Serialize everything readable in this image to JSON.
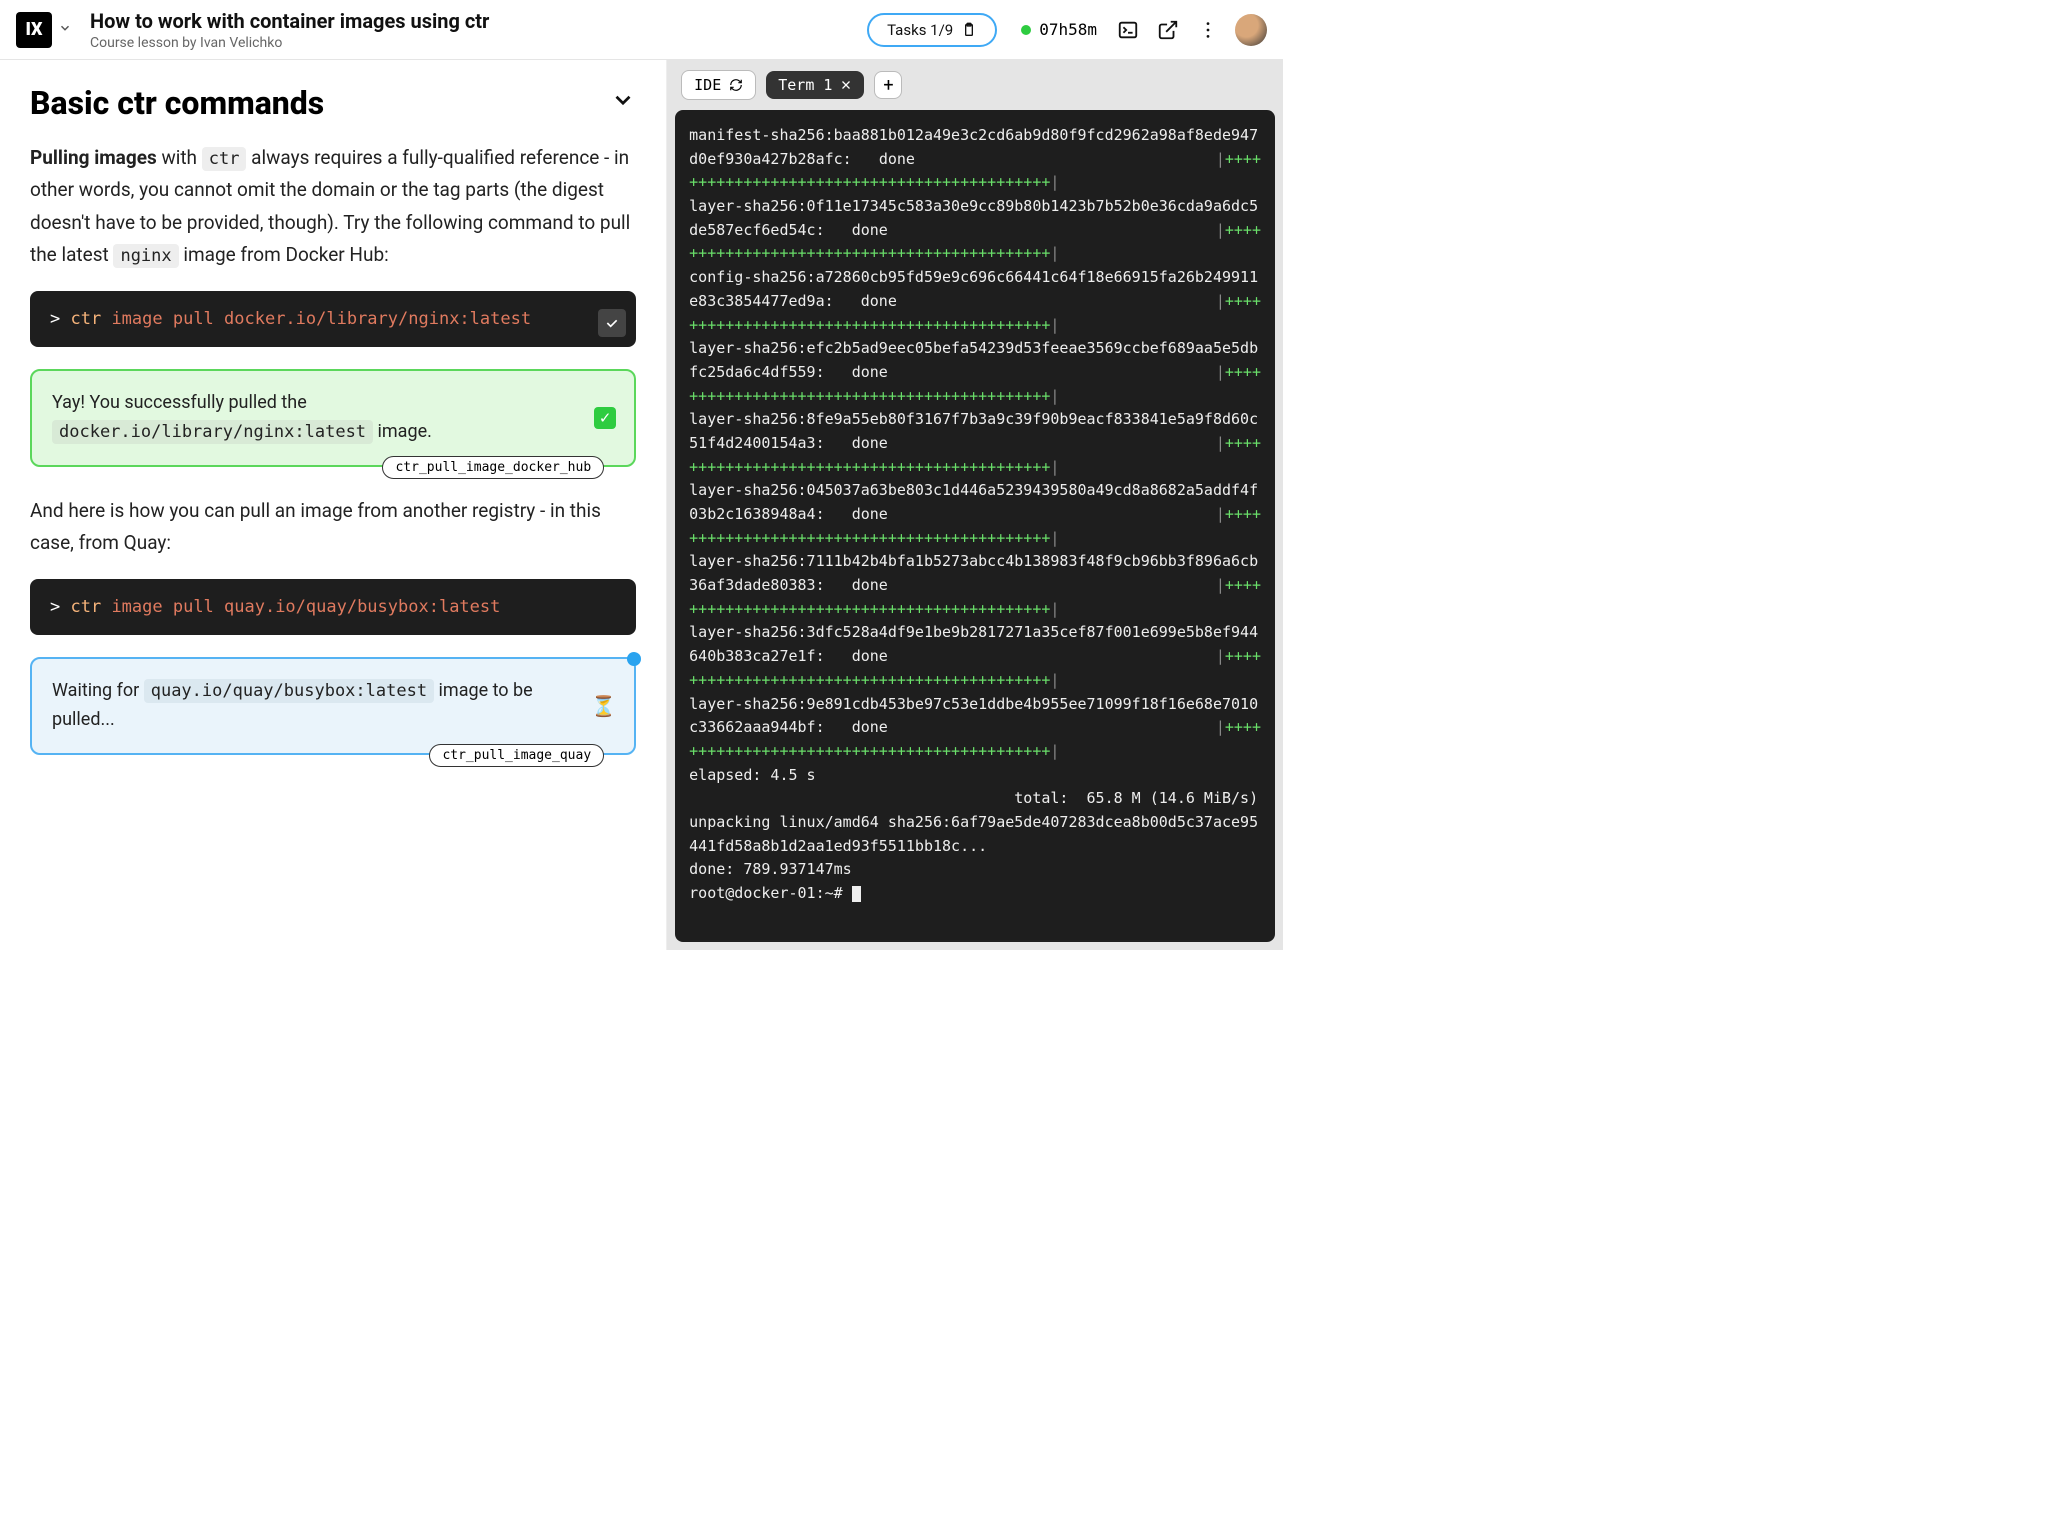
{
  "header": {
    "logo_text": "IX",
    "title": "How to work with container images using ctr",
    "subtitle": "Course lesson by Ivan Velichko",
    "tasks_label": "Tasks 1/9",
    "timer": "07h58m"
  },
  "lesson": {
    "section_title": "Basic ctr commands",
    "para1_strong": "Pulling images",
    "para1_a": " with ",
    "para1_code": "ctr",
    "para1_b": " always requires a fully-qualified reference - in other words, you cannot omit the domain or the tag parts (the digest doesn't have to be provided, though). Try the following command to pull the latest ",
    "para1_code2": "nginx",
    "para1_c": " image from Docker Hub:",
    "code1": {
      "prompt": "> ",
      "ctr": "ctr",
      "rest": " image pull docker.io/library/nginx:latest"
    },
    "success": {
      "text_a": "Yay! You successfully pulled the ",
      "code": "docker.io/library/nginx:latest",
      "text_b": " image.",
      "tag": "ctr_pull_image_docker_hub"
    },
    "para2": "And here is how you can pull an image from another registry - in this case, from Quay:",
    "code2": {
      "prompt": "> ",
      "ctr": "ctr",
      "rest": " image pull quay.io/quay/busybox:latest"
    },
    "waiting": {
      "text_a": "Waiting for ",
      "code": "quay.io/quay/busybox:latest",
      "text_b": " image to be pulled...",
      "tag": "ctr_pull_image_quay"
    }
  },
  "term_tabs": {
    "ide": "IDE",
    "term1": "Term 1"
  },
  "terminal": {
    "lines": [
      {
        "t": "hash",
        "txt": "manifest-sha256:baa881b012a49e3c2cd6ab9d80f9fcd2962a98af8ede947d0ef930a427b28afc:",
        "status": "done"
      },
      {
        "t": "plusline"
      },
      {
        "t": "hash",
        "txt": "layer-sha256:0f11e17345c583a30e9cc89b80b1423b7b52b0e36cda9a6dc5de587ecf6ed54c:",
        "status": "done"
      },
      {
        "t": "plusline"
      },
      {
        "t": "hash",
        "txt": "config-sha256:a72860cb95fd59e9c696c66441c64f18e66915fa26b249911e83c3854477ed9a:",
        "status": "done"
      },
      {
        "t": "plusline"
      },
      {
        "t": "hash",
        "txt": "layer-sha256:efc2b5ad9eec05befa54239d53feeae3569ccbef689aa5e5dbfc25da6c4df559:",
        "status": "done"
      },
      {
        "t": "plusline"
      },
      {
        "t": "hash",
        "txt": "layer-sha256:8fe9a55eb80f3167f7b3a9c39f90b9eacf833841e5a9f8d60c51f4d2400154a3:",
        "status": "done"
      },
      {
        "t": "plusline"
      },
      {
        "t": "hash",
        "txt": "layer-sha256:045037a63be803c1d446a5239439580a49cd8a8682a5addf4f03b2c1638948a4:",
        "status": "done"
      },
      {
        "t": "plusline"
      },
      {
        "t": "hash",
        "txt": "layer-sha256:7111b42b4bfa1b5273abcc4b138983f48f9cb96bb3f896a6cb36af3dade80383:",
        "status": "done"
      },
      {
        "t": "plusline"
      },
      {
        "t": "hash",
        "txt": "layer-sha256:3dfc528a4df9e1be9b2817271a35cef87f001e699e5b8ef944640b383ca27e1f:",
        "status": "done"
      },
      {
        "t": "plusline"
      },
      {
        "t": "hash",
        "txt": "layer-sha256:9e891cdb453be97c53e1ddbe4b955ee71099f18f16e68e7010c33662aaa944bf:",
        "status": "done"
      },
      {
        "t": "plusline"
      },
      {
        "t": "plain",
        "txt": "elapsed: 4.5 s"
      },
      {
        "t": "plain",
        "txt": "                                    total:  65.8 M (14.6 MiB/s)"
      },
      {
        "t": "plain",
        "txt": "unpacking linux/amd64 sha256:6af79ae5de407283dcea8b00d5c37ace95441fd58a8b1d2aa1ed93f5511bb18c..."
      },
      {
        "t": "plain",
        "txt": "done: 789.937147ms"
      },
      {
        "t": "prompt",
        "txt": "root@docker-01:~# "
      }
    ]
  }
}
